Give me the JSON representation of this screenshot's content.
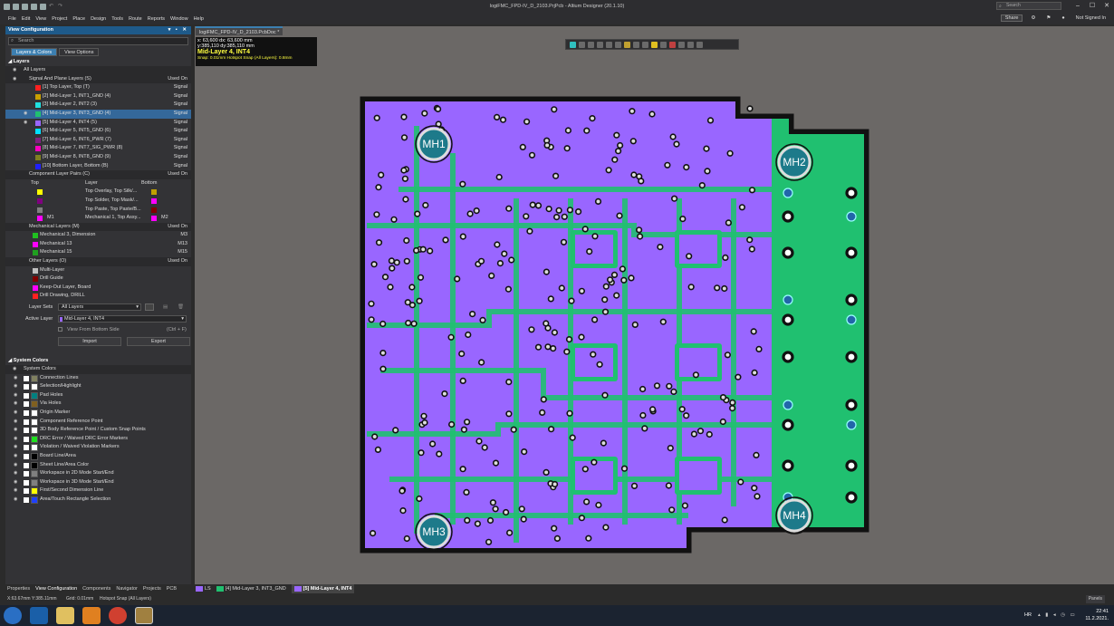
{
  "title": "logiFMC_FPD-IV_D_2103.PrjPcb - Altium Designer (20.1.10)",
  "search": {
    "placeholder": "Search"
  },
  "menu": [
    "File",
    "Edit",
    "View",
    "Project",
    "Place",
    "Design",
    "Tools",
    "Route",
    "Reports",
    "Window",
    "Help"
  ],
  "menu_right": {
    "share": "Share",
    "user": "Not Signed In"
  },
  "panel": {
    "title": "View Configuration",
    "search_placeholder": "Search",
    "tabs": [
      "Layers & Colors",
      "View Options"
    ],
    "layers_section": "Layers",
    "all_layers": "All Layers",
    "used_on": "Used On",
    "signal_group": "Signal And Plane Layers (S)",
    "signal_layers": [
      {
        "name": "[1] Top Layer, Top (T)",
        "type": "Signal",
        "color": "#ff2020"
      },
      {
        "name": "[2] Mid-Layer 1, INT1_GND (4)",
        "type": "Signal",
        "color": "#c8a000"
      },
      {
        "name": "[3] Mid-Layer 2, INT2 (3)",
        "type": "Signal",
        "color": "#20e0e0"
      },
      {
        "name": "[4] Mid-Layer 3, INT3_GND (4)",
        "type": "Signal",
        "color": "#20c070"
      },
      {
        "name": "[5] Mid-Layer 4, INT4 (5)",
        "type": "Signal",
        "color": "#9966ff"
      },
      {
        "name": "[6] Mid-Layer 5, INT5_GND (6)",
        "type": "Signal",
        "color": "#00e0ff"
      },
      {
        "name": "[7] Mid-Layer 6, INT6_PWR (7)",
        "type": "Signal",
        "color": "#802080"
      },
      {
        "name": "[8] Mid-Layer 7, INT7_SIG_PWR (8)",
        "type": "Signal",
        "color": "#ff00c0"
      },
      {
        "name": "[9] Mid-Layer 8, INT8_GND (9)",
        "type": "Signal",
        "color": "#808020"
      },
      {
        "name": "[10] Bottom Layer, Bottom (B)",
        "type": "Signal",
        "color": "#2020ff"
      }
    ],
    "pairs_group": "Component Layer Pairs (C)",
    "pairs_hdr": {
      "top": "Top",
      "layer": "Layer",
      "bottom": "Bottom"
    },
    "pairs": [
      {
        "top_color": "#ffff00",
        "top": "",
        "layer": "Top Overlay, Top Silk/...",
        "bottom_color": "#c0a000",
        "bottom": ""
      },
      {
        "top_color": "#800080",
        "top": "",
        "layer": "Top Solder, Top Mask/...",
        "bottom_color": "#ff00ff",
        "bottom": ""
      },
      {
        "top_color": "#808080",
        "top": "",
        "layer": "Top Paste, Top Paste/B...",
        "bottom_color": "#800000",
        "bottom": ""
      },
      {
        "top_color": "#ff00ff",
        "top": "M1",
        "layer": "Mechanical 1, Top Assy...",
        "bottom_color": "#ff00ff",
        "bottom": "M2"
      }
    ],
    "mech_group": "Mechanical Layers (M)",
    "mech_layers": [
      {
        "name": "Mechanical 3, Dimension",
        "code": "M3",
        "color": "#20c020"
      },
      {
        "name": "Mechanical 13",
        "code": "M13",
        "color": "#ff00ff"
      },
      {
        "name": "Mechanical 15",
        "code": "M15",
        "color": "#20a020"
      }
    ],
    "other_group": "Other Layers (O)",
    "other_layers": [
      {
        "name": "Multi-Layer",
        "color": "#c0c0c0"
      },
      {
        "name": "Drill Guide",
        "color": "#800000"
      },
      {
        "name": "Keep-Out Layer, Board",
        "color": "#ff00ff"
      },
      {
        "name": "Drill Drawing, DRILL",
        "color": "#ff2020"
      }
    ],
    "layer_sets_label": "Layer Sets",
    "layer_sets_value": "All Layers",
    "active_layer_label": "Active Layer",
    "active_layer_value": "Mid-Layer 4, INT4",
    "view_bottom_label": "View From Bottom Side",
    "view_bottom_shortcut": "(Ctrl + F)",
    "import": "Import",
    "export": "Export",
    "system_colors_section": "System Colors",
    "system_colors_hdr": "System Colors",
    "system_colors": [
      {
        "name": "Connection Lines",
        "color": "#808060"
      },
      {
        "name": "Selection/Highlight",
        "color": "#ffffff"
      },
      {
        "name": "Pad Holes",
        "color": "#008080"
      },
      {
        "name": "Via Holes",
        "color": "#806020"
      },
      {
        "name": "Origin Marker",
        "color": "#ffffff"
      },
      {
        "name": "Component Reference Point",
        "color": "#ffffff"
      },
      {
        "name": "3D Body Reference Point / Custom Snap Points",
        "color": "#ffffff"
      },
      {
        "name": "DRC Error / Waived DRC Error Markers",
        "color": "#20e020"
      },
      {
        "name": "Violation / Waived Violation Markers",
        "color": "#ffffff"
      },
      {
        "name": "Board Line/Area",
        "color": "#000000"
      },
      {
        "name": "Sheet Line/Area Color",
        "color": "#000000"
      },
      {
        "name": "Workspace in 2D Mode Start/End",
        "color": "#808080"
      },
      {
        "name": "Workspace in 3D Mode Start/End",
        "color": "#808080"
      },
      {
        "name": "First/Second Dimension Line",
        "color": "#ffff00"
      },
      {
        "name": "Area/Touch Rectangle Selection",
        "color": "#2040ff"
      }
    ]
  },
  "document_tab": "logiFMC_FPD-IV_D_2103.PcbDoc *",
  "hud": {
    "line1": "x: 63,600   dx: 63,600  mm",
    "line2": "y:385,110   dy:385,110  mm",
    "layer": "Mid-Layer 4, INT4",
    "snap": "Snap: 0.01mm Hotspot Snap (All Layers): 0.8mm"
  },
  "mounting_holes": [
    "MH1",
    "MH2",
    "MH3",
    "MH4"
  ],
  "bottom_tabs": [
    "Properties",
    "View Configuration",
    "Components",
    "Navigator",
    "Projects",
    "PCB"
  ],
  "layer_tabs": [
    {
      "label": "LS",
      "color": "#9966ff"
    },
    {
      "label": "[4] Mid-Layer 3, INT3_GND",
      "color": "#20c070"
    },
    {
      "label": "[5] Mid-Layer 4, INT4",
      "color": "#9966ff"
    }
  ],
  "status": {
    "coords": "X:63.67mm Y:385.11mm",
    "grid": "Grid: 0.01mm",
    "snap": "Hotspot Snap (All Layers)",
    "panels": "Panels"
  },
  "tray": {
    "lang": "HR",
    "time": "22:41",
    "date": "11.2.2021."
  },
  "colors": {
    "purple": "#9966ff",
    "green": "#20c070",
    "accent": "#3c7fb1"
  }
}
